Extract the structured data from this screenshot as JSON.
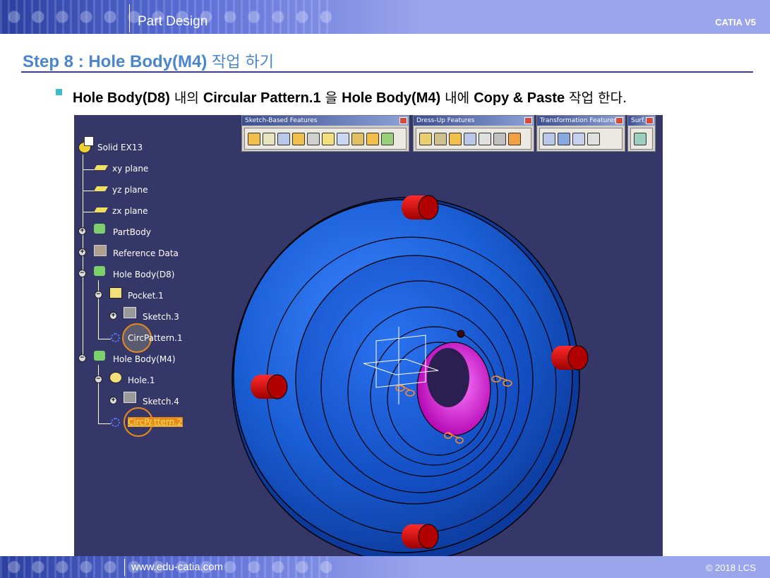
{
  "header": {
    "title": "Part Design",
    "product": "CATIA V5"
  },
  "step": {
    "title_en": "Step 8 : Hole Body(M4)",
    "title_kr": "작업 하기"
  },
  "instruction": [
    {
      "text": "Hole Body(D8)",
      "bold": true
    },
    {
      "text": " 내의 ",
      "bold": false
    },
    {
      "text": "Circular Pattern.1",
      "bold": true
    },
    {
      "text": " 을 ",
      "bold": false
    },
    {
      "text": "Hole Body(M4)",
      "bold": true
    },
    {
      "text": " 내에 ",
      "bold": false
    },
    {
      "text": "Copy & Paste",
      "bold": true
    },
    {
      "text": " 작업 한다.",
      "bold": false
    }
  ],
  "toolbars": [
    {
      "title": "Sketch-Based Features",
      "button_count": 11
    },
    {
      "title": "Dress-Up Features",
      "button_count": 8
    },
    {
      "title": "Transformation Features",
      "button_count": 4
    },
    {
      "title": "Surf...",
      "button_count": 1
    }
  ],
  "tree": {
    "root": "Solid EX13",
    "items": [
      {
        "label": "xy plane"
      },
      {
        "label": "yz plane"
      },
      {
        "label": "zx plane"
      },
      {
        "label": "PartBody"
      },
      {
        "label": "Reference Data"
      },
      {
        "label": "Hole Body(D8)"
      },
      {
        "label": "Pocket.1"
      },
      {
        "label": "Sketch.3"
      },
      {
        "label": "CircPattern.1"
      },
      {
        "label": "Hole Body(M4)"
      },
      {
        "label": "Hole.1"
      },
      {
        "label": "Sketch.4"
      },
      {
        "label": "CircPattern.2",
        "selected": true
      }
    ]
  },
  "colors": {
    "viewport_bg": "#353768",
    "part_blue": "#1a5fd6",
    "pin_red": "#d80000",
    "bore_magenta": "#e020e0",
    "highlight": "#e88a1c",
    "title_blue": "#4a86cf"
  },
  "footer": {
    "website": "www.edu-catia.com",
    "copyright": "© 2018 LCS"
  }
}
